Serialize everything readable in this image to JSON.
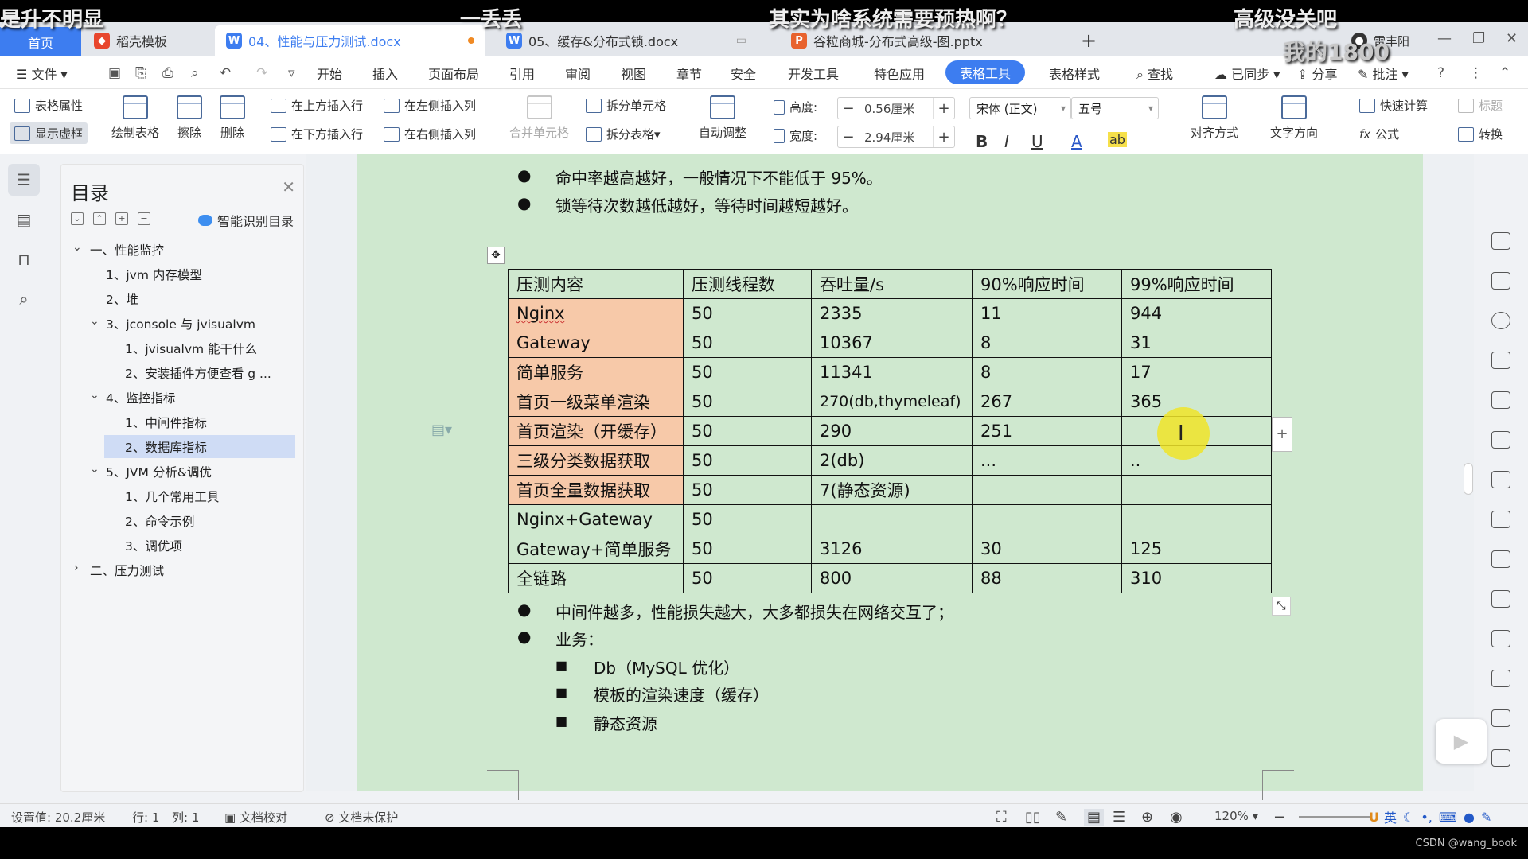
{
  "overlays": {
    "t1": "是升不明显",
    "t2": "一丢丢",
    "t3": "其实为啥系统需要预热啊？",
    "t4": "高级没关吧",
    "watermark": "我的1800"
  },
  "tabs": {
    "home": "首页",
    "t1": "稻壳模板",
    "t2": "04、性能与压力测试.docx",
    "t3": "05、缓存&分布式锁.docx",
    "t4": "谷粒商城-分布式高级-图.pptx",
    "add": "+",
    "user": "雷丰阳"
  },
  "menu": {
    "file": "文件",
    "items": [
      "开始",
      "插入",
      "页面布局",
      "引用",
      "审阅",
      "视图",
      "章节",
      "安全",
      "开发工具",
      "特色应用"
    ],
    "active": "表格工具",
    "table_style": "表格样式",
    "find": "查找",
    "synced": "已同步",
    "share": "分享",
    "comment": "批注"
  },
  "ribbon": {
    "table_props": "表格属性",
    "show_grid": "显示虚框",
    "draw_table": "绘制表格",
    "erase": "擦除",
    "delete": "删除",
    "ins_above": "在上方插入行",
    "ins_below": "在下方插入行",
    "ins_left": "在左侧插入列",
    "ins_right": "在右侧插入列",
    "merge": "合并单元格",
    "split_cell": "拆分单元格",
    "split_table": "拆分表格",
    "autofit": "自动调整",
    "height_label": "高度:",
    "height_value": "0.56厘米",
    "width_label": "宽度:",
    "width_value": "2.94厘米",
    "font": "宋体 (正文)",
    "size": "五号",
    "align": "对齐方式",
    "text_dir": "文字方向",
    "quick_calc": "快速计算",
    "formula": "公式",
    "title_row": "标题",
    "convert": "转换"
  },
  "toc": {
    "title": "目录",
    "ai": "智能识别目录",
    "items": [
      "一、性能监控",
      "1、jvm 内存模型",
      "2、堆",
      "3、jconsole 与 jvisualvm",
      "1、jvisualvm 能干什么",
      "2、安装插件方便查看 g ...",
      "4、监控指标",
      "1、中间件指标",
      "2、数据库指标",
      "5、JVM 分析&调优",
      "1、几个常用工具",
      "2、命令示例",
      "3、调优项",
      "二、压力测试"
    ]
  },
  "doc": {
    "b1": "命中率越高越好，一般情况下不能低于 95%。",
    "b2": "锁等待次数越低越好，等待时间越短越好。",
    "table": {
      "header": [
        "压测内容",
        "压测线程数",
        "吞吐量/s",
        "90%响应时间",
        "99%响应时间"
      ],
      "rows": [
        [
          "Nginx",
          "50",
          "2335",
          "11",
          "944"
        ],
        [
          "Gateway",
          "50",
          "10367",
          "8",
          "31"
        ],
        [
          "简单服务",
          "50",
          "11341",
          "8",
          "17"
        ],
        [
          "首页一级菜单渲染",
          "50",
          "270(db,thymeleaf)",
          "267",
          "365"
        ],
        [
          "首页渲染（开缓存）",
          "50",
          "290",
          "251",
          ""
        ],
        [
          "三级分类数据获取",
          "50",
          "2(db)",
          "...",
          ".."
        ],
        [
          "首页全量数据获取",
          "50",
          "7(静态资源)",
          "",
          ""
        ],
        [
          "Nginx+Gateway",
          "50",
          "",
          "",
          ""
        ],
        [
          "Gateway+简单服务",
          "50",
          "3126",
          "30",
          "125"
        ],
        [
          "全链路",
          "50",
          "800",
          "88",
          "310"
        ]
      ]
    },
    "b3": "中间件越多，性能损失越大，大多都损失在网络交互了；",
    "b4": "业务：",
    "s1": "Db（MySQL 优化）",
    "s2": "模板的渲染速度（缓存）",
    "s3": "静态资源"
  },
  "status": {
    "setting": "设置值: 20.2厘米",
    "row": "行: 1",
    "col": "列: 1",
    "proof": "文档校对",
    "protect": "文档未保护",
    "zoom": "120%",
    "ime": "英",
    "csdn": "CSDN @wang_book"
  }
}
